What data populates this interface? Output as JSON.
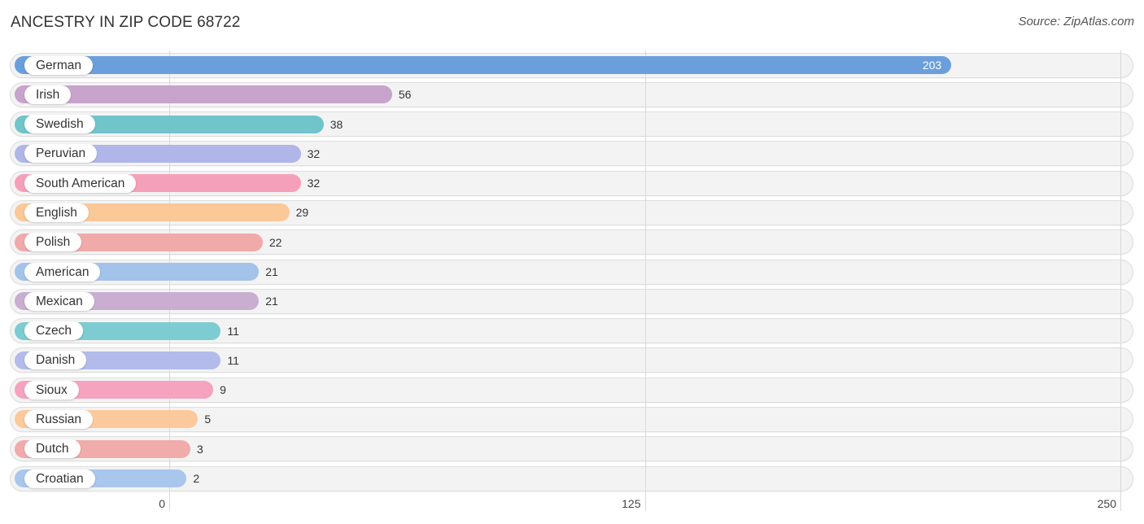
{
  "header": {
    "title": "ANCESTRY IN ZIP CODE 68722",
    "source": "Source: ZipAtlas.com"
  },
  "chart_data": {
    "type": "bar",
    "orientation": "horizontal",
    "title": "ANCESTRY IN ZIP CODE 68722",
    "xlabel": "",
    "ylabel": "",
    "xlim": [
      0,
      250
    ],
    "xticks": [
      0,
      125,
      250
    ],
    "xtick_labels": [
      "0",
      "125",
      "250"
    ],
    "grid": true,
    "categories": [
      "German",
      "Irish",
      "Swedish",
      "Peruvian",
      "South American",
      "English",
      "Polish",
      "American",
      "Mexican",
      "Czech",
      "Danish",
      "Sioux",
      "Russian",
      "Dutch",
      "Croatian"
    ],
    "values": [
      203,
      56,
      38,
      32,
      32,
      29,
      22,
      21,
      21,
      11,
      11,
      9,
      5,
      3,
      2
    ],
    "value_labels": [
      "203",
      "56",
      "38",
      "32",
      "32",
      "29",
      "22",
      "21",
      "21",
      "11",
      "11",
      "9",
      "5",
      "3",
      "2"
    ],
    "colors": [
      "#6a9fdb",
      "#c8a3cb",
      "#72c4cb",
      "#b0b6e8",
      "#f5a0bb",
      "#fbc898",
      "#f0aaa9",
      "#a4c3ea",
      "#c9aed1",
      "#7dccd2",
      "#b3bbeb",
      "#f5a3bf",
      "#fbc99c",
      "#f0abab",
      "#a9c6ec"
    ]
  }
}
